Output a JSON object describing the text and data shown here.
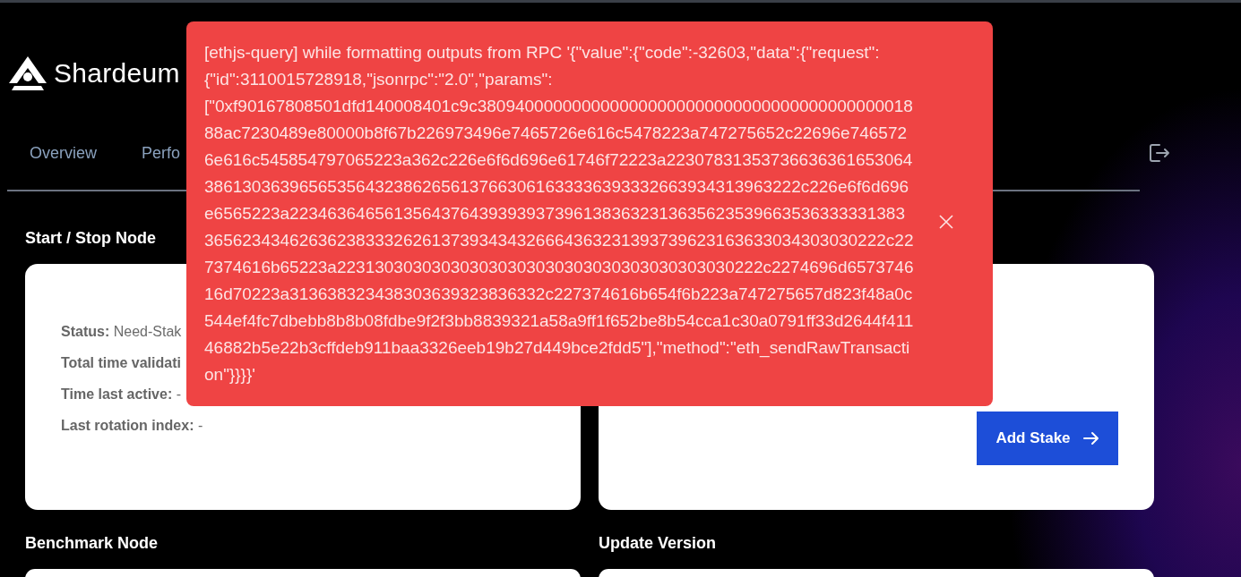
{
  "brand": {
    "name": "Shardeum"
  },
  "tabs": [
    {
      "label": "Overview"
    },
    {
      "label": "Perfo"
    }
  ],
  "sections": [
    {
      "kind": "status",
      "title": "Start / Stop Node",
      "fields": [
        "**Status:** Need-Stak",
        "**Total time validati**",
        "**Time last active:** -",
        "**Last rotation index:** -"
      ]
    },
    {
      "kind": "stake",
      "button": "Add Stake"
    },
    {
      "kind": "plain",
      "title": "Benchmark Node"
    },
    {
      "kind": "plain",
      "title": "Update Version"
    }
  ],
  "toast": {
    "message": "[ethjs-query] while formatting outputs from RPC '{\"value\":{\"code\":-32603,\"data\":{\"request\":{\"id\":3110015728918,\"jsonrpc\":\"2.0\",\"params\":[\"0xf90167808501dfd140008401c9c380940000000000000000000000000000000000000001888ac7230489e80000b8f67b226973496e7465726e616c5478223a747275652c22696e7465726e616c545854797065223a362c226e6f6d696e61746f72223a22307831353736636361653064386130363965653564323862656137663061633336393332663934313963222c226e6f6d696e6565223a22346364656135643764393939373961383632313635623539663536333331383365623434626362383332626137393434326664363231393739623163633034303030222c227374616b65223a223130303030303030303030303030303030303030222c2274696d657374616d70223a313638323438303639323836332c227374616b654f6b223a747275657d823f48a0c544ef4fc7dbebb8b8b08fdbe9f2f3bb8839321a58a9ff1f652be8b54cca1c30a0791ff33d2644f41146882b5e22b3cffdeb911baa3326eeb19b27d449bce2fdd5\"],\"method\":\"eth_sendRawTransaction\"}}}}'"
  }
}
